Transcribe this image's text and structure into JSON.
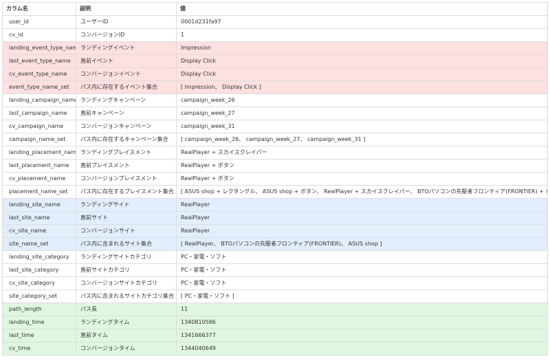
{
  "headers": {
    "column_name": "カラム名",
    "description": "説明",
    "value": "値"
  },
  "rows": [
    {
      "name": "user_id",
      "desc": "ユーザーID",
      "value": "0001d231fa97",
      "highlight": "white"
    },
    {
      "name": "cv_id",
      "desc": "コンバージョンID",
      "value": "1",
      "highlight": "white"
    },
    {
      "name": "landing_event_type_name",
      "desc": "ランディングイベント",
      "value": "Impression",
      "highlight": "red"
    },
    {
      "name": "last_event_type_name",
      "desc": "直前イベント",
      "value": "Display Click",
      "highlight": "red"
    },
    {
      "name": "cv_event_type_name",
      "desc": "コンバージョンイベント",
      "value": "Display Click",
      "highlight": "red"
    },
    {
      "name": "event_type_name_set",
      "desc": "パス内に存在するイベント集合",
      "value": "[ Impression、 Display Click ]",
      "highlight": "red"
    },
    {
      "name": "landing_campaign_name",
      "desc": "ランディングキャンペーン",
      "value": "campaign_week_26",
      "highlight": "white"
    },
    {
      "name": "last_campaign_name",
      "desc": "直前キャンペーン",
      "value": "campaign_week_27",
      "highlight": "white"
    },
    {
      "name": "cv_campaign_name",
      "desc": "コンバージョンキャンペーン",
      "value": "campaign_week_31",
      "highlight": "white"
    },
    {
      "name": "campaign_name_set",
      "desc": "パス内に存在するキャンペーン集合",
      "value": "[ campaign_week_26、 campaign_week_27、 campaign_week_31 ]",
      "highlight": "white"
    },
    {
      "name": "landing_placement_name",
      "desc": "ランディングプレイスメント",
      "value": "RealPlayer + スカイスクレイパー",
      "highlight": "white"
    },
    {
      "name": "last_placement_name",
      "desc": "直前プレイスメント",
      "value": "RealPlayer + ボタン",
      "highlight": "white"
    },
    {
      "name": "cv_placement_name",
      "desc": "コンバージョンプレイスメント",
      "value": "RealPlayer + ボタン",
      "highlight": "white"
    },
    {
      "name": "placement_name_set",
      "desc": "パス内に存在するプレイスメント集合",
      "value": "[ ASUS shop + レクタングル、 ASUS shop + ボタン、 RealPlayer + スカイスクレイパー、 BTOパソコンの先駆者フロンティア(FRONTIER) + ボタン ]",
      "highlight": "white"
    },
    {
      "name": "landing_site_name",
      "desc": "ランディングサイト",
      "value": "RealPlayer",
      "highlight": "blue"
    },
    {
      "name": "last_site_name",
      "desc": "直前サイト",
      "value": "RealPlayer",
      "highlight": "blue"
    },
    {
      "name": "cv_site_name",
      "desc": "コンバージョンサイト",
      "value": "RealPlayer",
      "highlight": "blue"
    },
    {
      "name": "site_name_set",
      "desc": "パス内に含まれるサイト集合",
      "value": "[ RealPlayer、 BTOパソコンの先駆者フロンティア(FRONTIER)、 ASUS shop ]",
      "highlight": "blue"
    },
    {
      "name": "landing_site_category",
      "desc": "ランディングサイトカテゴリ",
      "value": "PC・家電・ソフト",
      "highlight": "white"
    },
    {
      "name": "last_site_category",
      "desc": "直前サイトカテゴリ",
      "value": "PC・家電・ソフト",
      "highlight": "white"
    },
    {
      "name": "cv_site_category",
      "desc": "コンバージョンサイトカテゴリ",
      "value": "PC・家電・ソフト",
      "highlight": "white"
    },
    {
      "name": "site_category_set",
      "desc": "パス内に含まれるサイトカテゴリ集合",
      "value": "[ PC・家電・ソフト ]",
      "highlight": "white"
    },
    {
      "name": "path_length",
      "desc": "パス長",
      "value": "11",
      "highlight": "green"
    },
    {
      "name": "landing_time",
      "desc": "ランディングタイム",
      "value": "1340810586",
      "highlight": "green"
    },
    {
      "name": "last_time",
      "desc": "直前タイム",
      "value": "1341666377",
      "highlight": "green"
    },
    {
      "name": "cv_time",
      "desc": "コンバージョンタイム",
      "value": "1344040649",
      "highlight": "green"
    }
  ],
  "colors": {
    "white": "#ffffff",
    "red": "#fde0e0",
    "blue": "#e2eefc",
    "green": "#dff7de",
    "border": "#dddddd"
  }
}
